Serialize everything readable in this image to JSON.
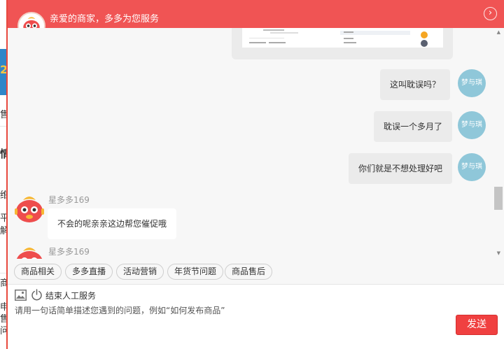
{
  "window": {
    "title": "亲爱的商家，多多为您服务",
    "close_glyph": "›"
  },
  "background_page": {
    "fragments": [
      "2",
      "售",
      "情",
      "维",
      "平",
      "解",
      "商",
      "申",
      "售",
      "问"
    ]
  },
  "messages": [
    {
      "side": "right",
      "text": "这叫耽误吗？",
      "avatar_text": "梦与琪"
    },
    {
      "side": "right",
      "text": "耽误一个多月了",
      "avatar_text": "梦与琪"
    },
    {
      "side": "right",
      "text": "你们就是不想处理好吧",
      "avatar_text": "梦与琪"
    },
    {
      "side": "left",
      "sender": "星多多169",
      "text": "不会的呢亲亲这边帮您催促哦"
    },
    {
      "side": "left",
      "sender": "星多多169",
      "text": ""
    }
  ],
  "quick_actions": [
    "商品相关",
    "多多直播",
    "活动营销",
    "年货节问题",
    "商品售后"
  ],
  "input": {
    "end_service_label": "结束人工服务",
    "value": "请用一句话简单描述您遇到的问题，例如“如何发布商品”",
    "send_label": "发送"
  },
  "icons": {
    "logo": "mascot-logo-icon",
    "close": "close-circle-icon",
    "image": "image-icon",
    "power": "power-icon"
  },
  "colors": {
    "brand_red": "#f05454",
    "send_red": "#f04040",
    "avatar_blue": "#8fc7d9"
  }
}
